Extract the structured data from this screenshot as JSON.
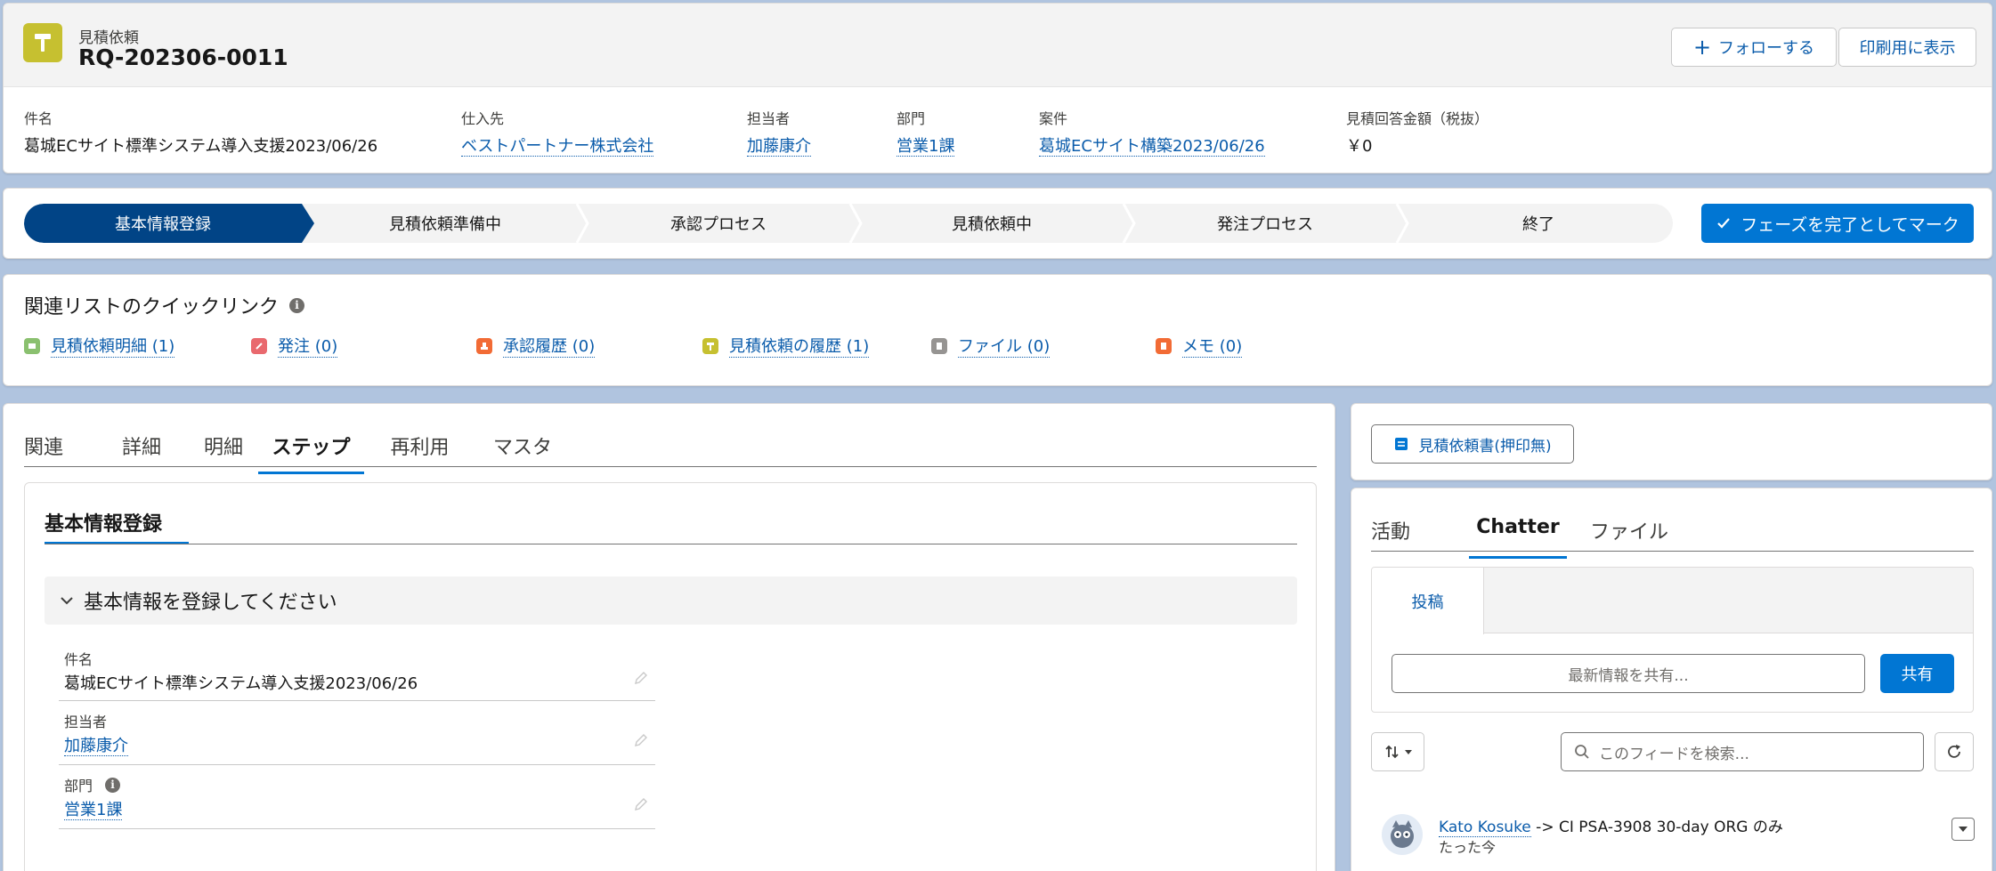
{
  "header": {
    "object_type": "見積依頼",
    "record_name": "RQ-202306-0011",
    "follow_label": "フォローする",
    "print_label": "印刷用に表示",
    "fields": [
      {
        "label": "件名",
        "value": "葛城ECサイト標準システム導入支援2023/06/26",
        "link": false
      },
      {
        "label": "仕入先",
        "value": "ベストパートナー株式会社",
        "link": true
      },
      {
        "label": "担当者",
        "value": "加藤康介",
        "link": true
      },
      {
        "label": "部門",
        "value": "営業1課",
        "link": true
      },
      {
        "label": "案件",
        "value": "葛城ECサイト構築2023/06/26",
        "link": true
      },
      {
        "label": "見積回答金額（税抜）",
        "value": "￥0",
        "link": false
      }
    ]
  },
  "path": {
    "stages": [
      "基本情報登録",
      "見積依頼準備中",
      "承認プロセス",
      "見積依頼中",
      "発注プロセス",
      "終了"
    ],
    "active_index": 0,
    "mark_complete_label": "フェーズを完了としてマーク"
  },
  "quick_links": {
    "title": "関連リストのクイックリンク",
    "items": [
      {
        "label": "見積依頼明細 (1)",
        "color": "#8ac06f"
      },
      {
        "label": "発注 (0)",
        "color": "#e9696e"
      },
      {
        "label": "承認履歴 (0)",
        "color": "#f26b35"
      },
      {
        "label": "見積依頼の履歴 (1)",
        "color": "#c6c030"
      },
      {
        "label": "ファイル (0)",
        "color": "#969492"
      },
      {
        "label": "メモ (0)",
        "color": "#f26b35"
      }
    ]
  },
  "main": {
    "tabs": [
      "関連",
      "詳細",
      "明細",
      "ステップ",
      "再利用",
      "マスタ"
    ],
    "active_tab": 3,
    "subtab": "基本情報登録",
    "section_title": "基本情報を登録してください",
    "fields": [
      {
        "label": "件名",
        "value": "葛城ECサイト標準システム導入支援2023/06/26",
        "link": false
      },
      {
        "label": "担当者",
        "value": "加藤康介",
        "link": true
      },
      {
        "label": "部門",
        "value": "営業1課",
        "link": true
      }
    ]
  },
  "right": {
    "doc_button": "見積依頼書(押印無)",
    "feed_tabs": [
      "活動",
      "Chatter",
      "ファイル"
    ],
    "active_feed_tab": 1,
    "publisher_tab": "投稿",
    "share_placeholder": "最新情報を共有...",
    "share_button": "共有",
    "search_placeholder": "このフィードを検索...",
    "feed_item": {
      "author": "Kato Kosuke",
      "rest": " -> CI PSA-3908 30-day ORG のみ",
      "time": "たった今"
    }
  },
  "colors": {
    "brand": "#0176d3",
    "path_active": "#014486",
    "record_icon": "#c6c030",
    "background": "#b0c4df"
  }
}
